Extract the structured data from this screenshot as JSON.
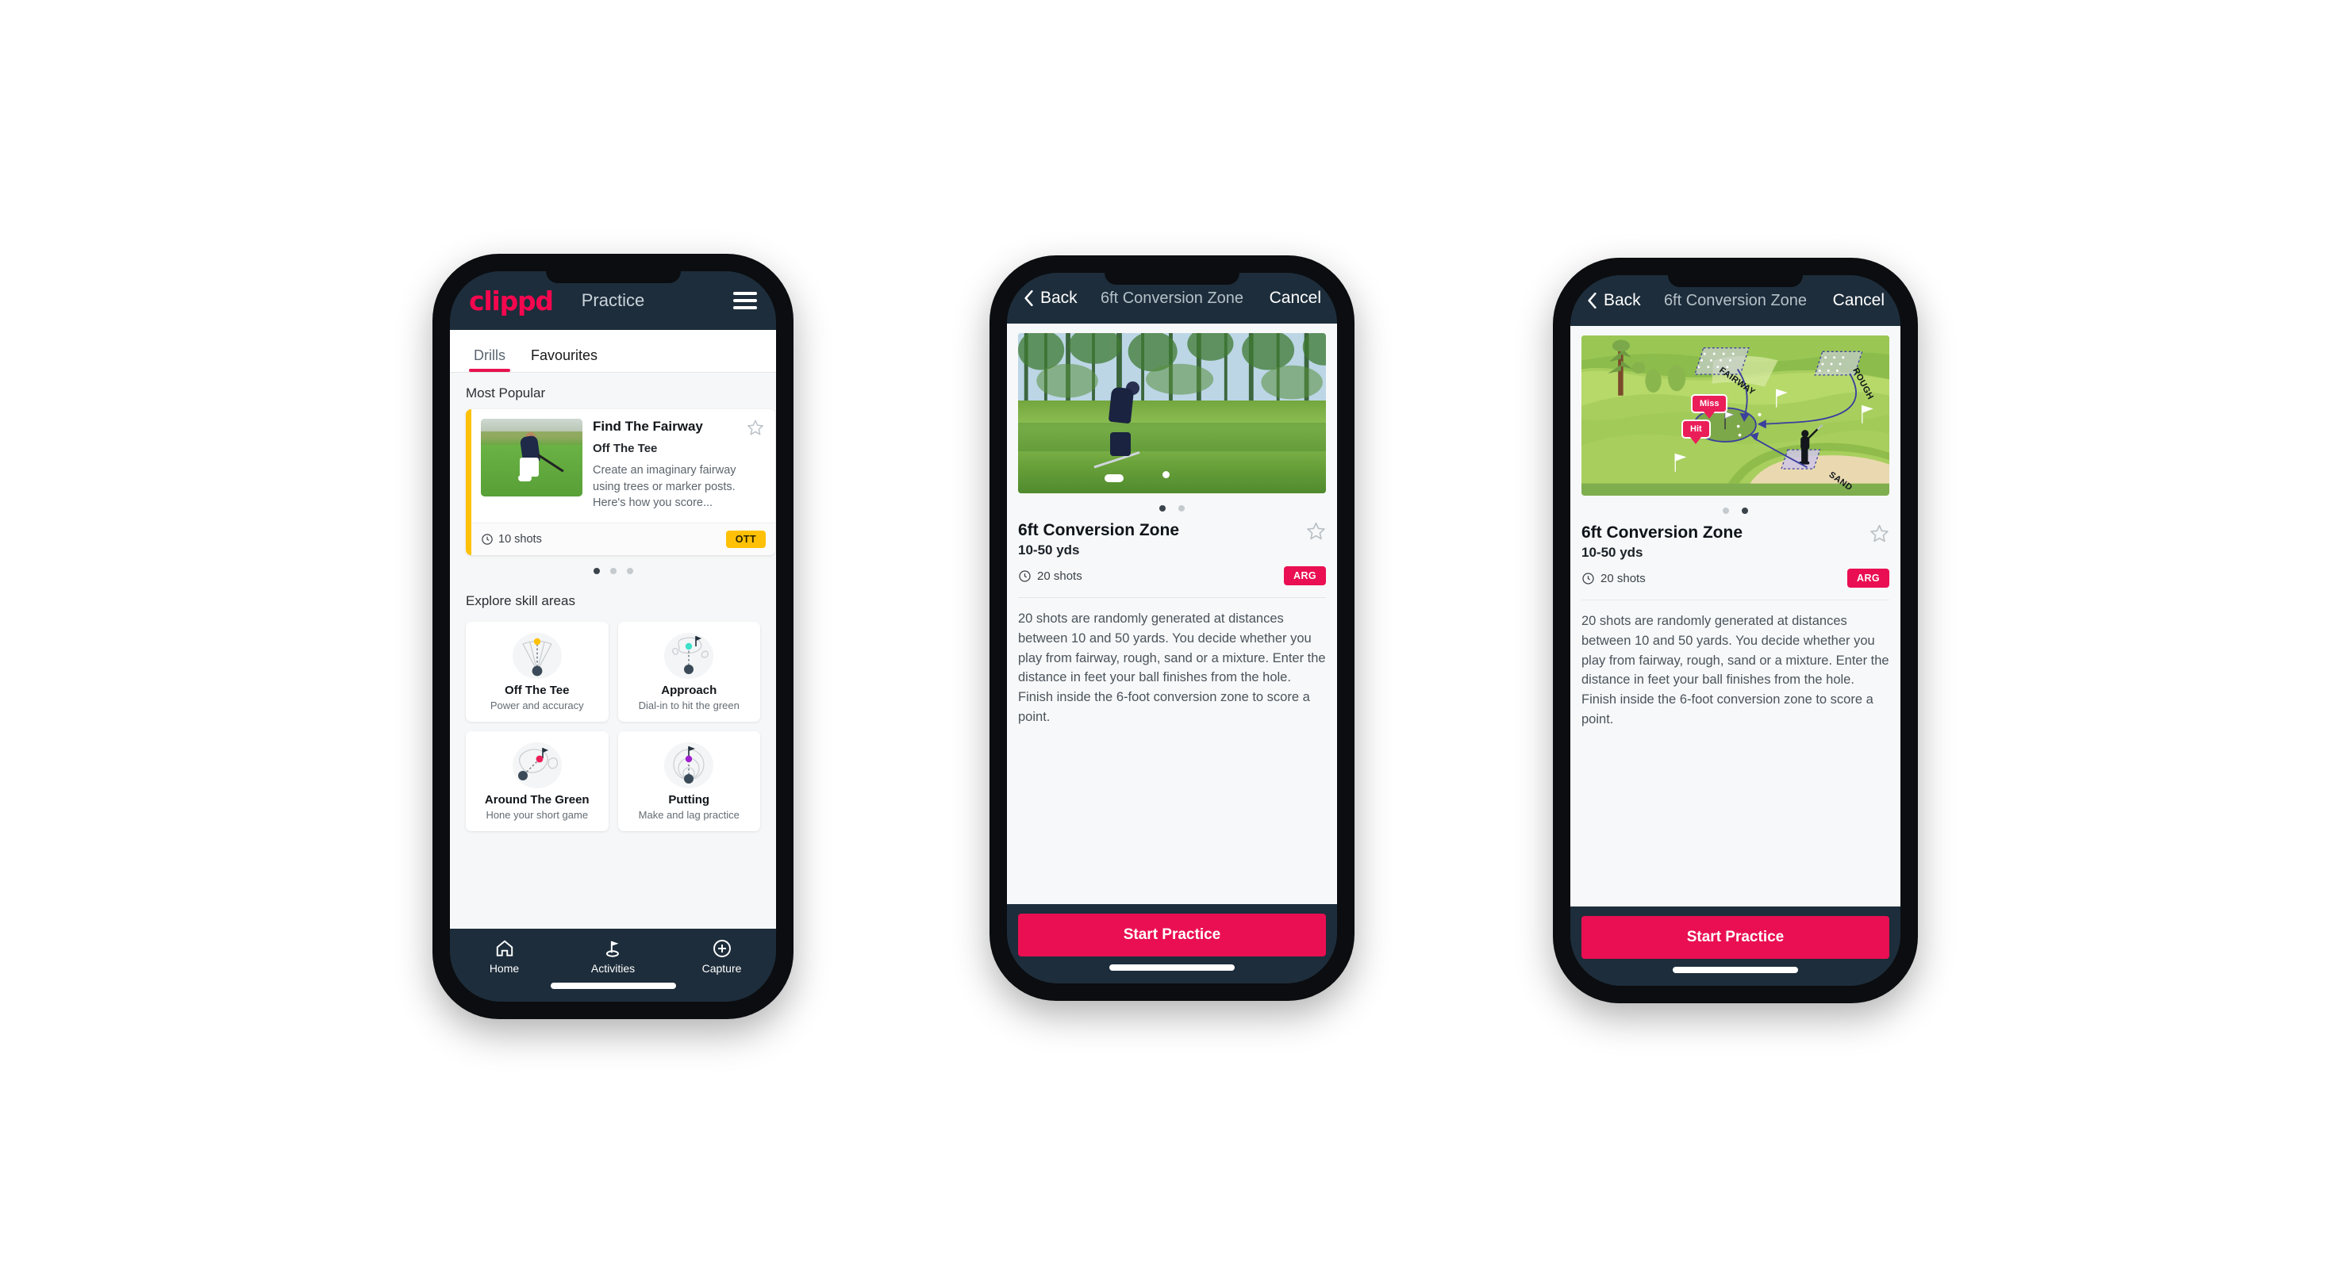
{
  "phone1": {
    "header": {
      "brand": "clippd",
      "title": "Practice",
      "menu_icon": "hamburger-menu-icon"
    },
    "tabs": [
      {
        "label": "Drills",
        "active": true
      },
      {
        "label": "Favourites",
        "active": false
      }
    ],
    "sections": {
      "most_popular": "Most Popular",
      "explore": "Explore skill areas"
    },
    "drill_card": {
      "title": "Find The Fairway",
      "subtitle": "Off The Tee",
      "description": "Create an imaginary fairway using trees or marker posts. Here's how you score...",
      "shots": "10 shots",
      "chip": "OTT",
      "chip_color": "#ffc107",
      "accent_color": "#ffc107",
      "next_accent_color": "#3de0c8",
      "star_icon": "star-outline-icon",
      "shots_icon": "clock-icon"
    },
    "carousel_dots": {
      "count": 3,
      "active": 0
    },
    "skill_areas": [
      {
        "name": "Off The Tee",
        "desc": "Power and accuracy",
        "icon": "off-the-tee-icon",
        "dot_color": "#ffc107"
      },
      {
        "name": "Approach",
        "desc": "Dial-in to hit the green",
        "icon": "approach-icon",
        "dot_color": "#3de0c8"
      },
      {
        "name": "Around The Green",
        "desc": "Hone your short game",
        "icon": "around-the-green-icon",
        "dot_color": "#ea1e58"
      },
      {
        "name": "Putting",
        "desc": "Make and lag practice",
        "icon": "putting-icon",
        "dot_color": "#a020d0"
      }
    ],
    "tabbar": [
      {
        "label": "Home",
        "icon": "home-icon",
        "active": false
      },
      {
        "label": "Activities",
        "icon": "golf-flag-icon",
        "active": true
      },
      {
        "label": "Capture",
        "icon": "plus-circle-icon",
        "active": false
      }
    ]
  },
  "phone2": {
    "nav": {
      "back": "Back",
      "title": "6ft Conversion Zone",
      "cancel": "Cancel",
      "back_icon": "chevron-left-icon"
    },
    "media_type": "photo-golfer-chipping",
    "carousel_dots": {
      "count": 2,
      "active": 0
    },
    "detail": {
      "title": "6ft Conversion Zone",
      "range": "10-50 yds",
      "shots": "20 shots",
      "chip": "ARG",
      "chip_color": "#ea0f52",
      "star_icon": "star-outline-icon",
      "shots_icon": "clock-icon",
      "description": "20 shots are randomly generated at distances between 10 and 50 yards. You decide whether you play from fairway, rough, sand or a mixture. Enter the distance in feet your ball finishes from the hole. Finish inside the 6-foot conversion zone to score a point."
    },
    "cta": "Start Practice"
  },
  "phone3": {
    "nav": {
      "back": "Back",
      "title": "6ft Conversion Zone",
      "cancel": "Cancel",
      "back_icon": "chevron-left-icon"
    },
    "media_type": "course-diagram",
    "course_labels": {
      "fairway": "FAIRWAY",
      "rough": "ROUGH",
      "sand": "SAND",
      "miss": "Miss",
      "hit": "Hit"
    },
    "carousel_dots": {
      "count": 2,
      "active": 1
    },
    "detail": {
      "title": "6ft Conversion Zone",
      "range": "10-50 yds",
      "shots": "20 shots",
      "chip": "ARG",
      "chip_color": "#ea0f52",
      "star_icon": "star-outline-icon",
      "shots_icon": "clock-icon",
      "description": "20 shots are randomly generated at distances between 10 and 50 yards. You decide whether you play from fairway, rough, sand or a mixture. Enter the distance in feet your ball finishes from the hole. Finish inside the 6-foot conversion zone to score a point."
    },
    "cta": "Start Practice"
  }
}
